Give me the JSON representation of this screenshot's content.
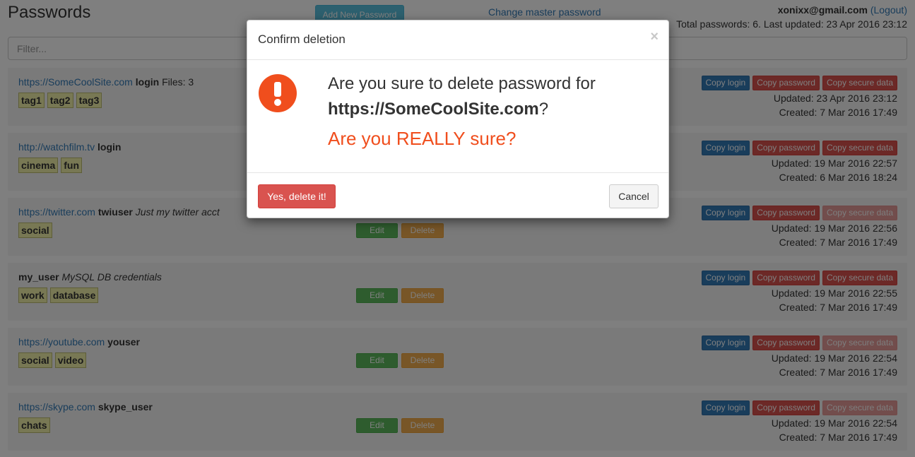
{
  "header": {
    "title": "Passwords",
    "add_button": "Add New Password",
    "master_link": "Change master password",
    "user_email": "xonixx@gmail.com",
    "logout": "(Logout)",
    "stats": "Total passwords: 6. Last updated: 23 Apr 2016 23:12"
  },
  "filter": {
    "placeholder": "Filter..."
  },
  "buttons": {
    "edit": "Edit",
    "delete": "Delete",
    "copy_login": "Copy login",
    "copy_password": "Copy password",
    "copy_secure": "Copy secure data"
  },
  "entries": [
    {
      "url": "https://SomeCoolSite.com",
      "login": "login",
      "extra": "Files: 3",
      "description": "",
      "tags": [
        "tag1",
        "tag2",
        "tag3"
      ],
      "updated": "Updated: 23 Apr 2016 23:12",
      "created": "Created: 7 Mar 2016 17:49",
      "secure_enabled": true
    },
    {
      "url": "http://watchfilm.tv",
      "login": "login",
      "extra": "",
      "description": "",
      "tags": [
        "cinema",
        "fun"
      ],
      "updated": "Updated: 19 Mar 2016 22:57",
      "created": "Created: 6 Mar 2016 18:24",
      "secure_enabled": true
    },
    {
      "url": "https://twitter.com",
      "login": "twiuser",
      "extra": "",
      "description": "Just my twitter acct",
      "tags": [
        "social"
      ],
      "updated": "Updated: 19 Mar 2016 22:56",
      "created": "Created: 7 Mar 2016 17:49",
      "secure_enabled": false
    },
    {
      "url": "",
      "login": "my_user",
      "extra": "",
      "description": "MySQL DB credentials",
      "tags": [
        "work",
        "database"
      ],
      "updated": "Updated: 19 Mar 2016 22:55",
      "created": "Created: 7 Mar 2016 17:49",
      "secure_enabled": true
    },
    {
      "url": "https://youtube.com",
      "login": "youser",
      "extra": "",
      "description": "",
      "tags": [
        "social",
        "video"
      ],
      "updated": "Updated: 19 Mar 2016 22:54",
      "created": "Created: 7 Mar 2016 17:49",
      "secure_enabled": false
    },
    {
      "url": "https://skype.com",
      "login": "skype_user",
      "extra": "",
      "description": "",
      "tags": [
        "chats"
      ],
      "updated": "Updated: 19 Mar 2016 22:54",
      "created": "Created: 7 Mar 2016 17:49",
      "secure_enabled": false
    }
  ],
  "modal": {
    "title": "Confirm deletion",
    "close": "×",
    "question_prefix": "Are you sure to delete password for",
    "site": "https://SomeCoolSite.com",
    "question_suffix": "?",
    "warning": "Are you REALLY sure?",
    "confirm_button": "Yes, delete it!",
    "cancel_button": "Cancel",
    "accent_color": "#f04e1d",
    "icon": "exclamation-circle-icon"
  }
}
